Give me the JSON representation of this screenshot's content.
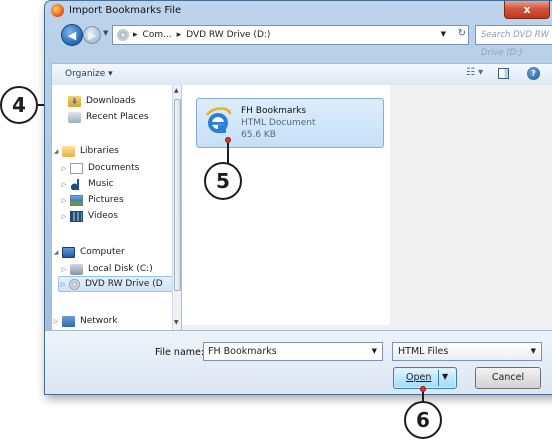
{
  "window": {
    "title": "Import Bookmarks File",
    "close_label": "x"
  },
  "address": {
    "segments": [
      "Com...",
      "DVD RW Drive (D:)"
    ],
    "search_placeholder": "Search DVD RW Drive (D:)"
  },
  "toolbar": {
    "organize_label": "Organize ▾"
  },
  "nav": {
    "items": [
      {
        "label": "Downloads"
      },
      {
        "label": "Recent Places"
      },
      {
        "label": "Libraries"
      },
      {
        "label": "Documents"
      },
      {
        "label": "Music"
      },
      {
        "label": "Pictures"
      },
      {
        "label": "Videos"
      },
      {
        "label": "Computer"
      },
      {
        "label": "Local Disk (C:)"
      },
      {
        "label": "DVD RW Drive (D"
      },
      {
        "label": "Network"
      }
    ]
  },
  "file": {
    "name": "FH Bookmarks",
    "type": "HTML Document",
    "size": "65.6 KB"
  },
  "footer": {
    "filename_label": "File name:",
    "filename_value": "FH Bookmarks",
    "filetype_value": "HTML Files",
    "open_label": "Open",
    "cancel_label": "Cancel"
  },
  "callouts": {
    "four": "4",
    "five": "5",
    "six": "6"
  },
  "colors": {
    "accent": "#2a6cb8",
    "selection": "#cfe3f8",
    "callout_dot": "#e4322b"
  }
}
